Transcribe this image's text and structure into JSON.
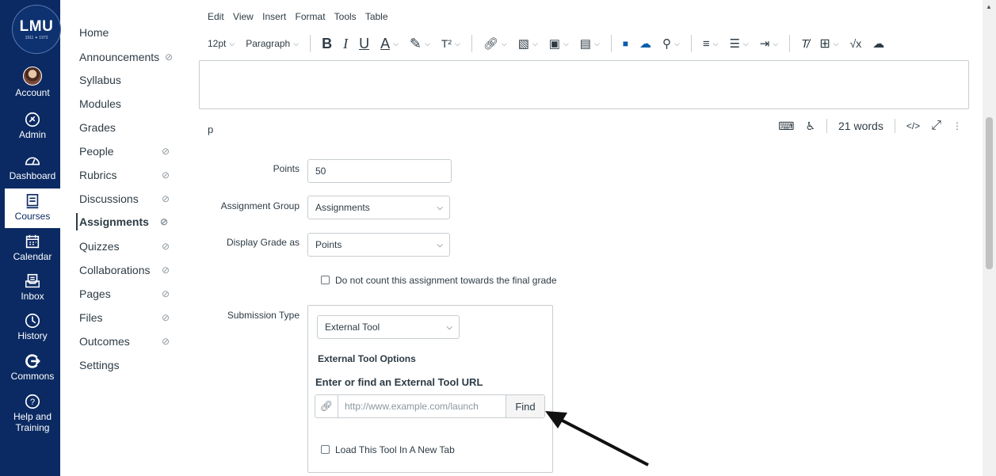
{
  "global_nav": {
    "logo": {
      "text": "LMU",
      "sub": "1911 ✦ 1973"
    },
    "items": [
      {
        "label": "Account",
        "icon": "avatar"
      },
      {
        "label": "Admin",
        "icon": "shield-icon"
      },
      {
        "label": "Dashboard",
        "icon": "dashboard-icon"
      },
      {
        "label": "Courses",
        "icon": "courses-icon"
      },
      {
        "label": "Calendar",
        "icon": "calendar-icon"
      },
      {
        "label": "Inbox",
        "icon": "inbox-icon"
      },
      {
        "label": "History",
        "icon": "clock-icon"
      },
      {
        "label": "Commons",
        "icon": "commons-icon"
      },
      {
        "label": "Help and",
        "label2": "Training",
        "icon": "help-icon"
      }
    ]
  },
  "course_nav": {
    "items": [
      {
        "label": "Home"
      },
      {
        "label": "Announcements",
        "hidden": true
      },
      {
        "label": "Syllabus"
      },
      {
        "label": "Modules"
      },
      {
        "label": "Grades"
      },
      {
        "label": "People",
        "hidden": true
      },
      {
        "label": "Rubrics",
        "hidden": true
      },
      {
        "label": "Discussions",
        "hidden": true
      },
      {
        "label": "Assignments",
        "hidden": true,
        "active": true
      },
      {
        "label": "Quizzes",
        "hidden": true
      },
      {
        "label": "Collaborations",
        "hidden": true
      },
      {
        "label": "Pages",
        "hidden": true
      },
      {
        "label": "Files",
        "hidden": true
      },
      {
        "label": "Outcomes",
        "hidden": true
      },
      {
        "label": "Settings"
      }
    ],
    "hidden_glyph": "⊘"
  },
  "editor": {
    "menu": [
      "Edit",
      "View",
      "Insert",
      "Format",
      "Tools",
      "Table"
    ],
    "font_size": "12pt",
    "block_format": "Paragraph",
    "status_path": "p",
    "word_count": "21 words",
    "html_toggle": "</>"
  },
  "form": {
    "points_label": "Points",
    "points_value": "50",
    "group_label": "Assignment Group",
    "group_value": "Assignments",
    "display_label": "Display Grade as",
    "display_value": "Points",
    "omit_label": "Do not count this assignment towards the final grade",
    "submission_label": "Submission Type",
    "submission_value": "External Tool",
    "ext_options_title": "External Tool Options",
    "ext_url_title": "Enter or find an External Tool URL",
    "ext_url_placeholder": "http://www.example.com/launch",
    "find_label": "Find",
    "new_tab_label": "Load This Tool In A New Tab"
  },
  "colors": {
    "nav_bg": "#0b2a63",
    "text": "#2d3b45",
    "border": "#c7cdd1"
  }
}
